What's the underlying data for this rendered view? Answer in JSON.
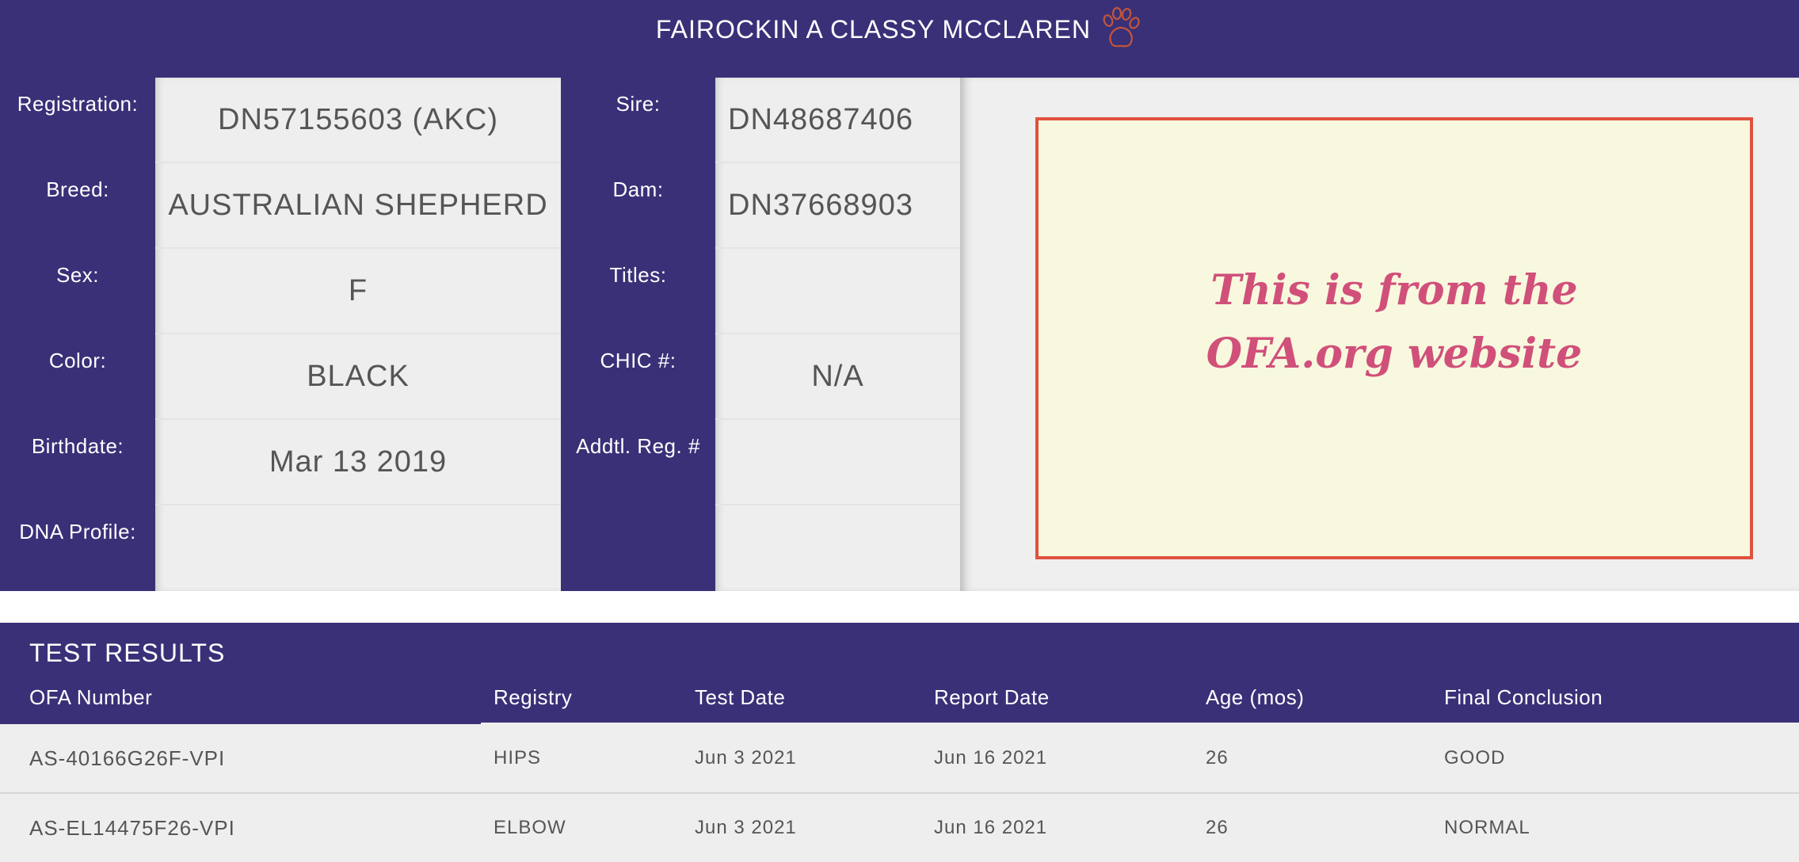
{
  "header": {
    "title": "FAIROCKIN A CLASSY MCCLAREN",
    "icon": "paw-icon"
  },
  "left_labels": [
    "Registration:",
    "Breed:",
    "Sex:",
    "Color:",
    "Birthdate:",
    "DNA Profile:"
  ],
  "left_values": [
    "DN57155603 (AKC)",
    "AUSTRALIAN SHEPHERD",
    "F",
    "BLACK",
    "Mar 13 2019",
    ""
  ],
  "mid_labels": [
    "Sire:",
    "Dam:",
    "Titles:",
    "CHIC #:",
    "Addtl. Reg. #",
    ""
  ],
  "mid_values": [
    "DN48687406",
    "DN37668903",
    "",
    "N/A",
    "",
    ""
  ],
  "note": "This is from the OFA.org website",
  "results": {
    "title": "TEST RESULTS",
    "columns": [
      "OFA Number",
      "Registry",
      "Test Date",
      "Report Date",
      "Age (mos)",
      "Final Conclusion"
    ],
    "rows": [
      [
        "AS-40166G26F-VPI",
        "HIPS",
        "Jun 3 2021",
        "Jun 16 2021",
        "26",
        "GOOD"
      ],
      [
        "AS-EL14475F26-VPI",
        "ELBOW",
        "Jun 3 2021",
        "Jun 16 2021",
        "26",
        "NORMAL"
      ]
    ]
  },
  "colors": {
    "purple": "#3a3078",
    "note_text": "#d0507a",
    "note_border": "#e0513f",
    "note_bg": "#f8f8de"
  }
}
